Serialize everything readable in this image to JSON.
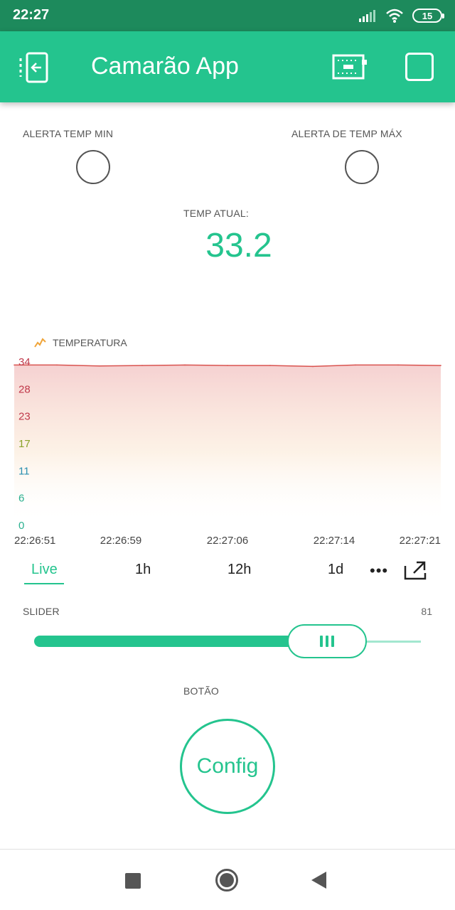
{
  "status_bar": {
    "time": "22:27",
    "battery_level": "15",
    "icons": [
      "signal-icon",
      "wifi-icon",
      "battery-icon"
    ]
  },
  "app_bar": {
    "title": "Camarão App",
    "icons": [
      "back-icon",
      "device-icon",
      "add-widget-icon"
    ],
    "accent_color": "#24c48e"
  },
  "led_widgets": [
    {
      "label": "ALERTA TEMP MIN",
      "state": "off"
    },
    {
      "label": "ALERTA DE TEMP MÁX",
      "state": "off"
    }
  ],
  "temp_display": {
    "label": "TEMP ATUAL:",
    "value": "33.2"
  },
  "chart_data": {
    "type": "area",
    "title": "TEMPERATURA",
    "series": [
      {
        "name": "TEMPERATURA",
        "color": "#d9534f",
        "x": [
          "22:26:51",
          "22:26:54",
          "22:26:57",
          "22:27:00",
          "22:27:03",
          "22:27:06",
          "22:27:09",
          "22:27:12",
          "22:27:15",
          "22:27:18",
          "22:27:21"
        ],
        "values": [
          33.2,
          33.2,
          33.0,
          33.1,
          33.2,
          33.1,
          33.1,
          32.9,
          33.2,
          33.2,
          33.1
        ]
      }
    ],
    "x_tick_labels": [
      "22:26:51",
      "22:26:59",
      "22:27:06",
      "22:27:14",
      "22:27:21"
    ],
    "y_tick_labels": [
      "34",
      "28",
      "23",
      "17",
      "11",
      "6",
      "0"
    ],
    "ylim": [
      0,
      34
    ],
    "grid": false,
    "legend": "top-left"
  },
  "range_tabs": {
    "items": [
      "Live",
      "1h",
      "12h",
      "1d"
    ],
    "selected": "Live",
    "more_label": "•••"
  },
  "slider": {
    "label": "SLIDER",
    "value_text": "81",
    "value": 81,
    "max": 100
  },
  "button_widget": {
    "label": "BOTÃO",
    "button_text": "Config"
  },
  "nav_bar": {
    "icons": [
      "recent-apps-icon",
      "home-icon",
      "back-icon"
    ]
  }
}
